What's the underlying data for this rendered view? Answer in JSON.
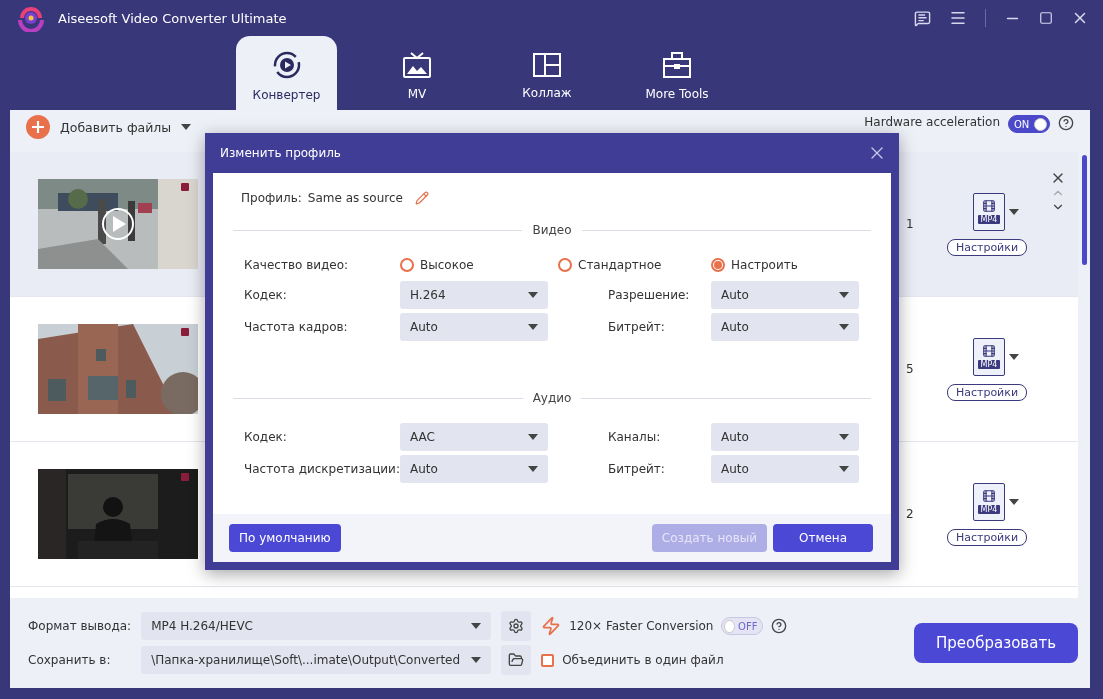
{
  "app": {
    "title": "Aiseesoft Video Converter Ultimate"
  },
  "nav_tabs": [
    {
      "label": "Конвертер",
      "kind": "converter",
      "selected": true
    },
    {
      "label": "MV",
      "kind": "mv",
      "selected": false
    },
    {
      "label": "Коллаж",
      "kind": "collage",
      "selected": false
    },
    {
      "label": "More Tools",
      "kind": "tools",
      "selected": false
    }
  ],
  "toolbar": {
    "add_files": "Добавить файлы",
    "hardware_acceleration": {
      "label": "Hardware acceleration",
      "on": true,
      "toggle_text": "ON"
    }
  },
  "files": [
    {
      "selected": true,
      "kind": "picture",
      "column_3": "1",
      "format": "MP4",
      "settings": "Настройки"
    },
    {
      "selected": false,
      "kind": "picture",
      "column_3": "5",
      "format": "MP4",
      "settings": "Настройки"
    },
    {
      "selected": false,
      "kind": "picture",
      "column_3": "2",
      "format": "MP4",
      "settings": "Настройки"
    }
  ],
  "dialog": {
    "title": "Изменить профиль",
    "profile_label": "Профиль:",
    "profile_value": "Same as source",
    "video_heading": "Видео",
    "quality_label": "Качество видео:",
    "quality_options": [
      {
        "label": "Высокое",
        "selected": false
      },
      {
        "label": "Стандартное",
        "selected": false
      },
      {
        "label": "Настроить",
        "selected": true
      }
    ],
    "video_fields": [
      {
        "label": "Кодек:",
        "value": "H.264"
      },
      {
        "label": "Разрешение:",
        "value": "Auto"
      },
      {
        "label": "Частота кадров:",
        "value": "Auto"
      },
      {
        "label": "Битрейт:",
        "value": "Auto"
      }
    ],
    "audio_heading": "Аудио",
    "audio_fields": [
      {
        "label": "Кодек:",
        "value": "AAC"
      },
      {
        "label": "Каналы:",
        "value": "Auto"
      },
      {
        "label": "Частота дискретизации:",
        "value": "Auto"
      },
      {
        "label": "Битрейт:",
        "value": "Auto"
      }
    ],
    "default_button": "По умолчанию",
    "create_button": {
      "label": "Создать новый",
      "disabled": true
    },
    "cancel_button": "Отмена"
  },
  "bottom": {
    "format_label": "Формат вывода:",
    "format_value": "MP4 H.264/HEVC",
    "save_label": "Сохранить в:",
    "save_value": "\\Папка-хранилище\\Soft\\...imate\\Output\\Converted",
    "faster": {
      "label": "120× Faster Conversion",
      "on": false,
      "toggle_text": "OFF"
    },
    "merge": {
      "label": "Объединить в один файл",
      "checked": false
    },
    "convert_button": "Преобразовать"
  }
}
